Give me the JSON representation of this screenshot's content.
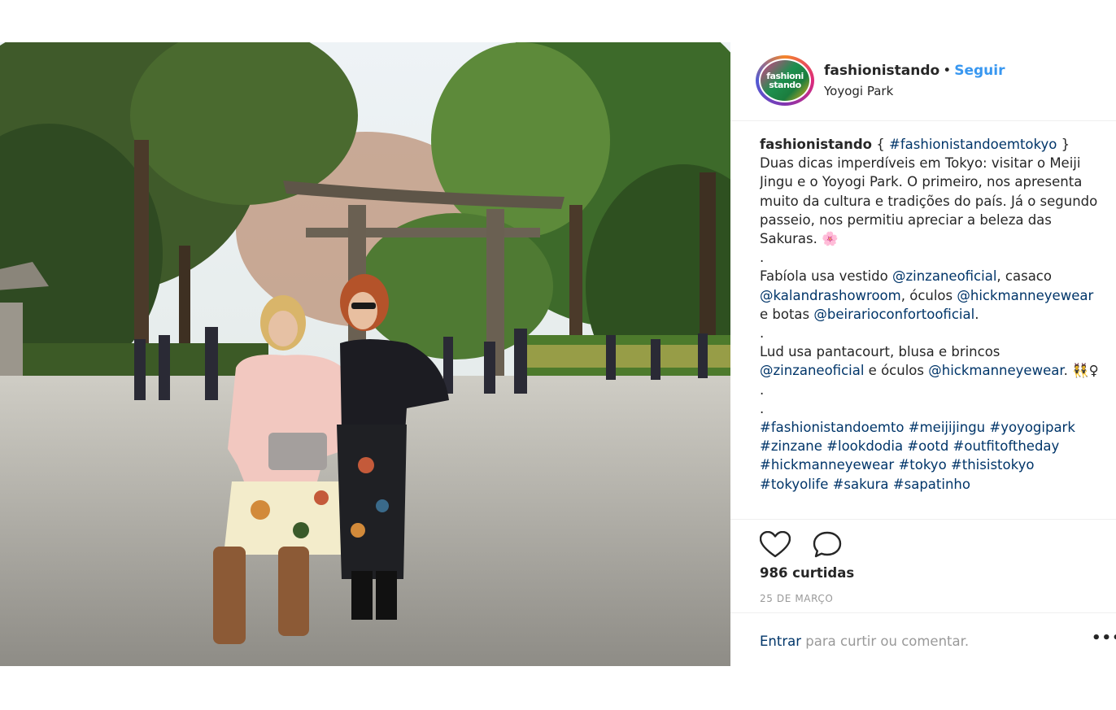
{
  "post": {
    "image_alt": "",
    "carousel": {
      "count": 2,
      "active_index": 1
    }
  },
  "header": {
    "username": "fashionistando",
    "separator": "•",
    "follow_label": "Seguir",
    "location": "Yoyogi Park",
    "avatar_text": "fashionistando"
  },
  "caption": {
    "username": "fashionistando",
    "open_brace": "{",
    "title_tag": "#fashionistandoemtokyo",
    "close_brace": "}",
    "text1": "Duas dicas imperdíveis em Tokyo: visitar o Meiji Jingu e o Yoyogi Park. O primeiro, nos apresenta muito da cultura e tradições do país. Já o segundo passeio, nos permitiu apreciar a beleza das Sakuras. 🌸",
    "dot1": ".",
    "fabiola_1": "Fabíola usa vestido ",
    "m_zinzane": "@zinzaneoficial",
    "fabiola_2": ", casaco ",
    "m_kalandra": "@kalandrashowroom",
    "fabiola_3": ", óculos ",
    "m_hickmann": "@hickmanneyewear",
    "fabiola_4": " e botas ",
    "m_beirario": "@beirarioconfortooficial",
    "fabiola_5": ".",
    "dot2": ".",
    "lud_1": "Lud usa pantacourt, blusa e brincos ",
    "m_zinzane2": "@zinzaneoficial",
    "lud_2": " e óculos ",
    "m_hickmann2": "@hickmanneyewear",
    "lud_3": ". 👯♀",
    "dot3": ".",
    "dot4": ".",
    "hashtags": [
      "#fashionistandoemto",
      "#meijijingu",
      "#yoyogipark",
      "#zinzane",
      "#lookdodia",
      "#ootd",
      "#outfitoftheday",
      "#hickmanneyewear",
      "#tokyo",
      "#thisistokyo",
      "#tokyolife",
      "#sakura",
      "#sapatinho"
    ]
  },
  "actions": {
    "like_icon": "heart-icon",
    "comment_icon": "comment-icon",
    "likes": "986 curtidas",
    "date": "25 DE MARÇO"
  },
  "footer": {
    "login_label": "Entrar",
    "rest": " para curtir ou comentar.",
    "more_label": "•••"
  },
  "colors": {
    "link": "#003569",
    "follow": "#3897f0",
    "muted": "#999999",
    "border": "#efefef"
  }
}
